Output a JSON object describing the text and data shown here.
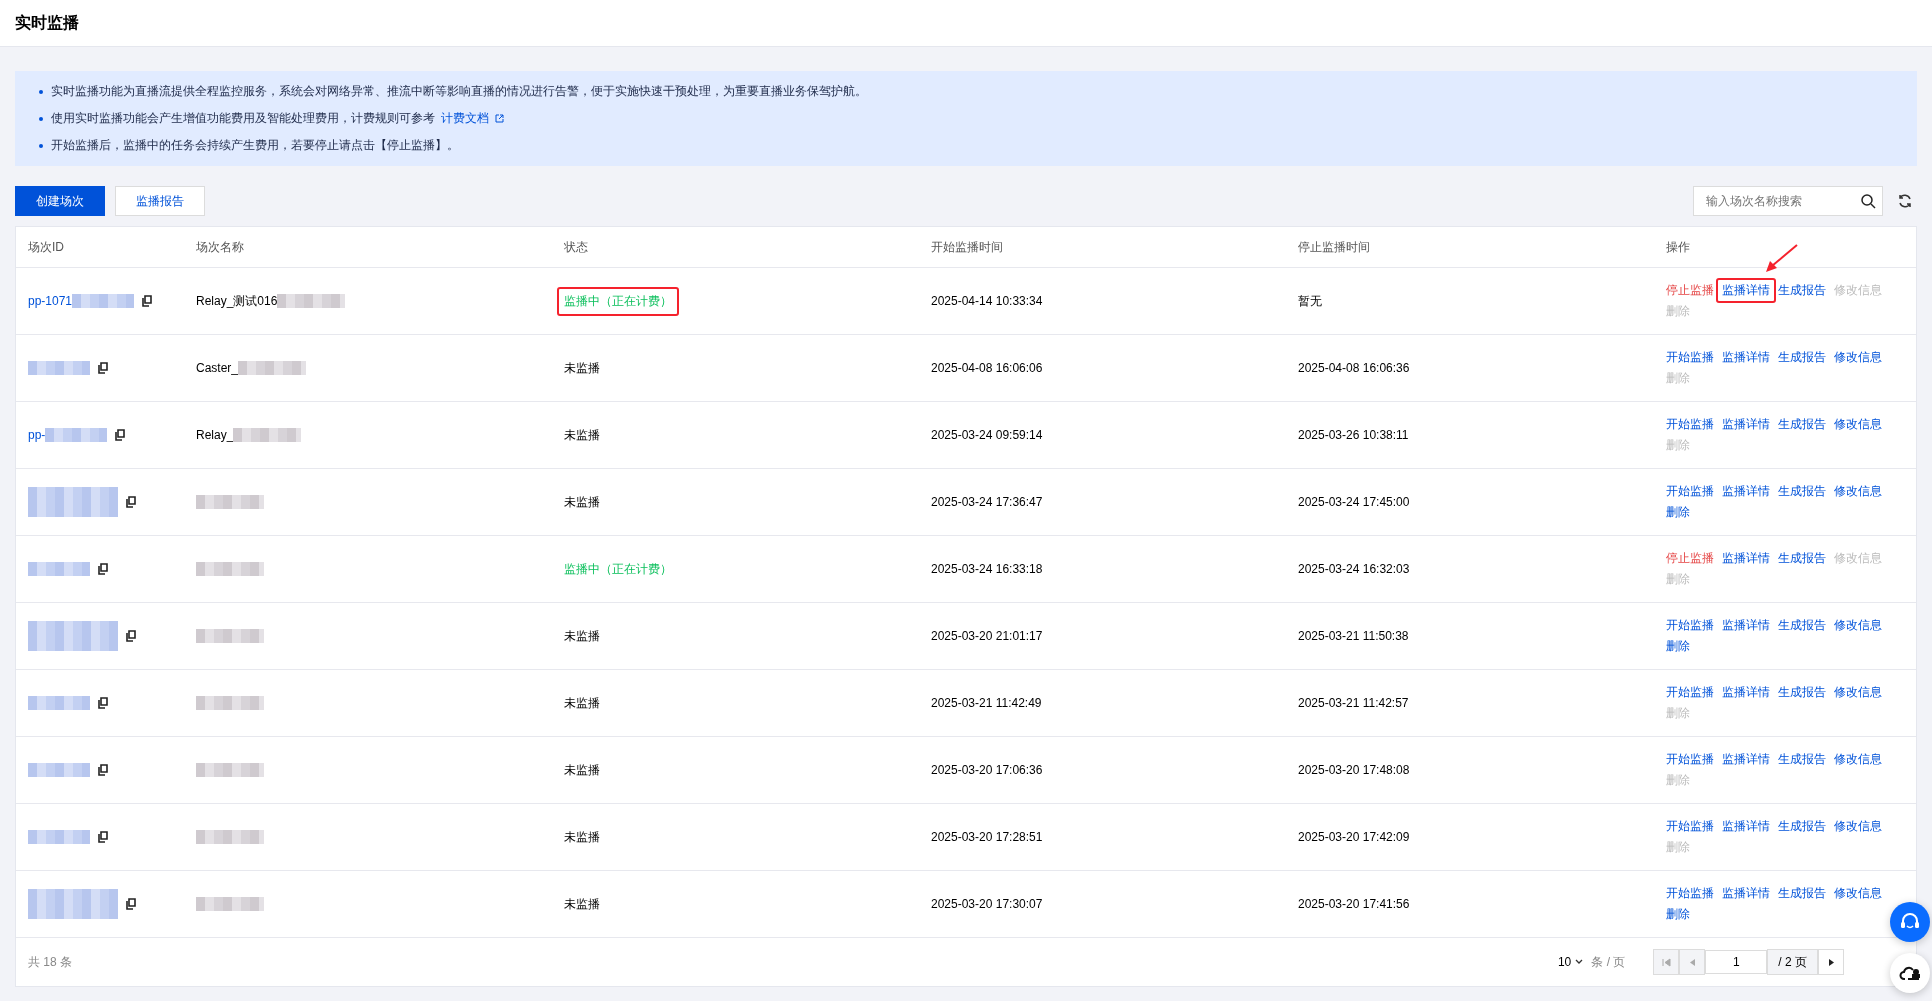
{
  "page_title": "实时监播",
  "notice": {
    "items": [
      {
        "text": "实时监播功能为直播流提供全程监控服务，系统会对网络异常、推流中断等影响直播的情况进行告警，便于实施快速干预处理，为重要直播业务保驾护航。"
      },
      {
        "text": "使用实时监播功能会产生增值功能费用及智能处理费用，计费规则可参考",
        "link": "计费文档"
      },
      {
        "text": "开始监播后，监播中的任务会持续产生费用，若要停止请点击【停止监播】。"
      }
    ]
  },
  "toolbar": {
    "buttons": [
      {
        "label": "创建场次",
        "kind": "primary"
      },
      {
        "label": "监播报告",
        "kind": "default"
      }
    ],
    "search": {
      "placeholder": "输入场次名称搜索"
    }
  },
  "table": {
    "columns": [
      "场次ID",
      "场次名称",
      "状态",
      "开始监播时间",
      "停止监播时间",
      "操作"
    ],
    "rows": [
      {
        "annotated": true,
        "id": {
          "text": "pp-1071",
          "blurred": true,
          "wrapped": false
        },
        "name": {
          "text": "Relay_测试016",
          "blurred": true
        },
        "status": {
          "text": "监播中（正在计费）",
          "kind": "active"
        },
        "start": "2025-04-14 10:33:34",
        "stop": "暂无",
        "actions": [
          {
            "label": "停止监播",
            "kind": "stop",
            "disabled": false
          },
          {
            "label": "监播详情",
            "kind": "link",
            "disabled": false
          },
          {
            "label": "生成报告",
            "kind": "link",
            "disabled": false
          },
          {
            "label": "修改信息",
            "kind": "link",
            "disabled": true
          },
          {
            "label": "删除",
            "kind": "link",
            "disabled": true
          }
        ]
      },
      {
        "annotated": false,
        "id": {
          "blurred": true,
          "wrapped": false
        },
        "name": {
          "text": "Caster_",
          "blurred": true
        },
        "status": {
          "text": "未监播",
          "kind": "idle"
        },
        "start": "2025-04-08 16:06:06",
        "stop": "2025-04-08 16:06:36",
        "actions": [
          {
            "label": "开始监播",
            "kind": "link",
            "disabled": false
          },
          {
            "label": "监播详情",
            "kind": "link",
            "disabled": false
          },
          {
            "label": "生成报告",
            "kind": "link",
            "disabled": false
          },
          {
            "label": "修改信息",
            "kind": "link",
            "disabled": false
          },
          {
            "label": "删除",
            "kind": "link",
            "disabled": true
          }
        ]
      },
      {
        "annotated": false,
        "id": {
          "text": "pp-",
          "blurred": true,
          "wrapped": false
        },
        "name": {
          "text": "Relay_",
          "blurred": true
        },
        "status": {
          "text": "未监播",
          "kind": "idle"
        },
        "start": "2025-03-24 09:59:14",
        "stop": "2025-03-26 10:38:11",
        "actions": [
          {
            "label": "开始监播",
            "kind": "link",
            "disabled": false
          },
          {
            "label": "监播详情",
            "kind": "link",
            "disabled": false
          },
          {
            "label": "生成报告",
            "kind": "link",
            "disabled": false
          },
          {
            "label": "修改信息",
            "kind": "link",
            "disabled": false
          },
          {
            "label": "删除",
            "kind": "link",
            "disabled": true
          }
        ]
      },
      {
        "annotated": false,
        "id": {
          "blurred": true,
          "wrapped": true
        },
        "name": {
          "blurred": true
        },
        "status": {
          "text": "未监播",
          "kind": "idle"
        },
        "start": "2025-03-24 17:36:47",
        "stop": "2025-03-24 17:45:00",
        "actions": [
          {
            "label": "开始监播",
            "kind": "link",
            "disabled": false
          },
          {
            "label": "监播详情",
            "kind": "link",
            "disabled": false
          },
          {
            "label": "生成报告",
            "kind": "link",
            "disabled": false
          },
          {
            "label": "修改信息",
            "kind": "link",
            "disabled": false
          },
          {
            "label": "删除",
            "kind": "link",
            "disabled": false
          }
        ]
      },
      {
        "annotated": false,
        "id": {
          "blurred": true,
          "wrapped": false
        },
        "name": {
          "blurred": true
        },
        "status": {
          "text": "监播中（正在计费）",
          "kind": "active"
        },
        "start": "2025-03-24 16:33:18",
        "stop": "2025-03-24 16:32:03",
        "actions": [
          {
            "label": "停止监播",
            "kind": "stop",
            "disabled": false
          },
          {
            "label": "监播详情",
            "kind": "link",
            "disabled": false
          },
          {
            "label": "生成报告",
            "kind": "link",
            "disabled": false
          },
          {
            "label": "修改信息",
            "kind": "link",
            "disabled": true
          },
          {
            "label": "删除",
            "kind": "link",
            "disabled": true
          }
        ]
      },
      {
        "annotated": false,
        "id": {
          "blurred": true,
          "wrapped": true
        },
        "name": {
          "blurred": true
        },
        "status": {
          "text": "未监播",
          "kind": "idle"
        },
        "start": "2025-03-20 21:01:17",
        "stop": "2025-03-21 11:50:38",
        "actions": [
          {
            "label": "开始监播",
            "kind": "link",
            "disabled": false
          },
          {
            "label": "监播详情",
            "kind": "link",
            "disabled": false
          },
          {
            "label": "生成报告",
            "kind": "link",
            "disabled": false
          },
          {
            "label": "修改信息",
            "kind": "link",
            "disabled": false
          },
          {
            "label": "删除",
            "kind": "link",
            "disabled": false
          }
        ]
      },
      {
        "annotated": false,
        "id": {
          "blurred": true,
          "wrapped": false
        },
        "name": {
          "blurred": true
        },
        "status": {
          "text": "未监播",
          "kind": "idle"
        },
        "start": "2025-03-21 11:42:49",
        "stop": "2025-03-21 11:42:57",
        "actions": [
          {
            "label": "开始监播",
            "kind": "link",
            "disabled": false
          },
          {
            "label": "监播详情",
            "kind": "link",
            "disabled": false
          },
          {
            "label": "生成报告",
            "kind": "link",
            "disabled": false
          },
          {
            "label": "修改信息",
            "kind": "link",
            "disabled": false
          },
          {
            "label": "删除",
            "kind": "link",
            "disabled": true
          }
        ]
      },
      {
        "annotated": false,
        "id": {
          "blurred": true,
          "wrapped": false
        },
        "name": {
          "blurred": true
        },
        "status": {
          "text": "未监播",
          "kind": "idle"
        },
        "start": "2025-03-20 17:06:36",
        "stop": "2025-03-20 17:48:08",
        "actions": [
          {
            "label": "开始监播",
            "kind": "link",
            "disabled": false
          },
          {
            "label": "监播详情",
            "kind": "link",
            "disabled": false
          },
          {
            "label": "生成报告",
            "kind": "link",
            "disabled": false
          },
          {
            "label": "修改信息",
            "kind": "link",
            "disabled": false
          },
          {
            "label": "删除",
            "kind": "link",
            "disabled": true
          }
        ]
      },
      {
        "annotated": false,
        "id": {
          "blurred": true,
          "wrapped": false
        },
        "name": {
          "blurred": true
        },
        "status": {
          "text": "未监播",
          "kind": "idle"
        },
        "start": "2025-03-20 17:28:51",
        "stop": "2025-03-20 17:42:09",
        "actions": [
          {
            "label": "开始监播",
            "kind": "link",
            "disabled": false
          },
          {
            "label": "监播详情",
            "kind": "link",
            "disabled": false
          },
          {
            "label": "生成报告",
            "kind": "link",
            "disabled": false
          },
          {
            "label": "修改信息",
            "kind": "link",
            "disabled": false
          },
          {
            "label": "删除",
            "kind": "link",
            "disabled": true
          }
        ]
      },
      {
        "annotated": false,
        "id": {
          "blurred": true,
          "wrapped": true
        },
        "name": {
          "blurred": true
        },
        "status": {
          "text": "未监播",
          "kind": "idle"
        },
        "start": "2025-03-20 17:30:07",
        "stop": "2025-03-20 17:41:56",
        "actions": [
          {
            "label": "开始监播",
            "kind": "link",
            "disabled": false
          },
          {
            "label": "监播详情",
            "kind": "link",
            "disabled": false
          },
          {
            "label": "生成报告",
            "kind": "link",
            "disabled": false
          },
          {
            "label": "修改信息",
            "kind": "link",
            "disabled": false
          },
          {
            "label": "删除",
            "kind": "link",
            "disabled": false
          }
        ]
      }
    ]
  },
  "footer": {
    "total": "共 18 条",
    "page_size": "10",
    "page_size_unit": "条 / 页",
    "page_input": "1",
    "page_total": "/ 2 页"
  }
}
